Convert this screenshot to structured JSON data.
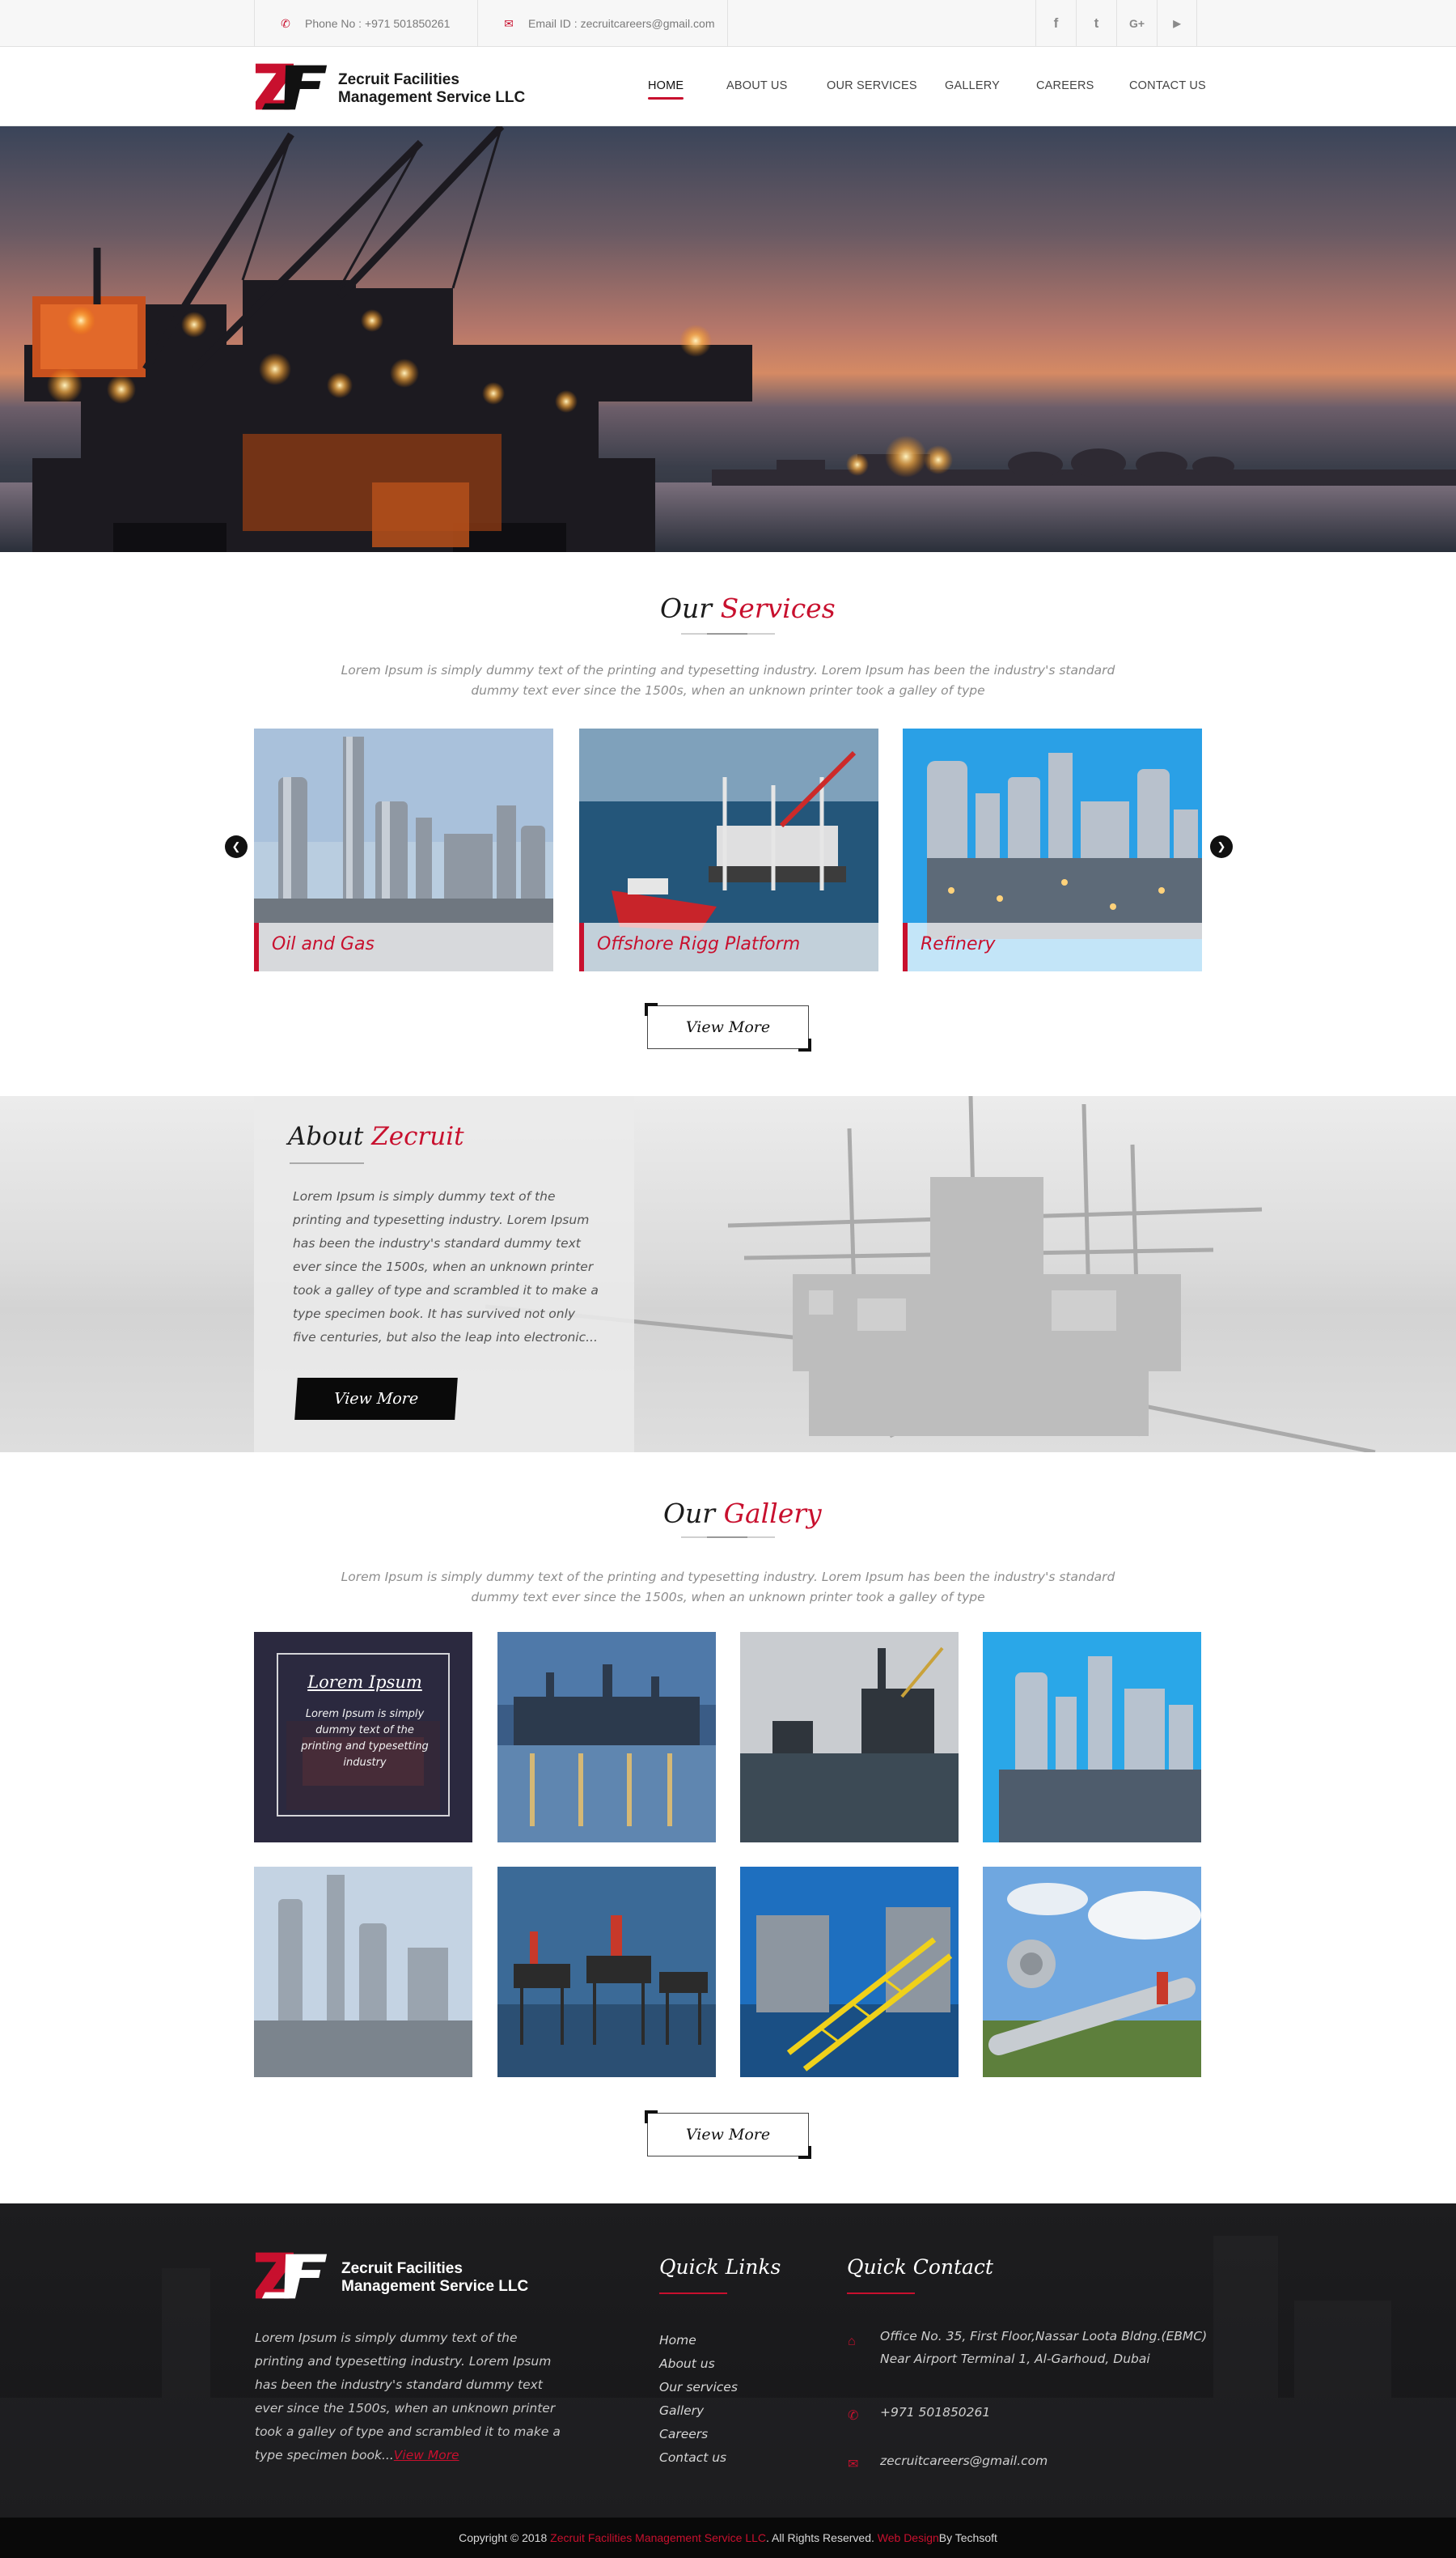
{
  "topbar": {
    "phone": "Phone No : +971 501850261",
    "email": "Email ID : zecruitcareers@gmail.com",
    "social": [
      {
        "name": "facebook",
        "glyph": "f"
      },
      {
        "name": "twitter",
        "glyph": "t"
      },
      {
        "name": "google-plus",
        "glyph": "G+"
      },
      {
        "name": "youtube",
        "glyph": "▶"
      }
    ]
  },
  "brand": {
    "line1": "Zecruit Facilities",
    "line2": "Management Service LLC",
    "accent": "#c8102e"
  },
  "nav": [
    {
      "label": "HOME",
      "active": true
    },
    {
      "label": "ABOUT US",
      "active": false
    },
    {
      "label": "OUR SERVICES",
      "active": false
    },
    {
      "label": "GALLERY",
      "active": false
    },
    {
      "label": "CAREERS",
      "active": false
    },
    {
      "label": "CONTACT US",
      "active": false
    }
  ],
  "services": {
    "title_dark": "Our",
    "title_red": "Services",
    "intro": "Lorem Ipsum is simply dummy text of the printing and typesetting industry. Lorem Ipsum has been the industry's standard dummy text ever since the 1500s, when an unknown printer took a galley of type",
    "cards": [
      {
        "label": "Oil and Gas"
      },
      {
        "label": "Offshore Rigg Platform"
      },
      {
        "label": "Refinery"
      }
    ],
    "button": "View More"
  },
  "about": {
    "title_dark": "About",
    "title_red": "Zecruit",
    "text": "Lorem Ipsum is simply dummy text of the printing and typesetting industry. Lorem Ipsum has been the industry's standard dummy text ever since the 1500s, when an unknown printer took a galley of type and scrambled it to make a type specimen book. It has survived not only five centuries, but also the leap into electronic...",
    "button": "View More"
  },
  "gallery": {
    "title_dark": "Our",
    "title_red": "Gallery",
    "intro": "Lorem Ipsum is simply dummy text of the printing and typesetting industry. Lorem Ipsum has been the industry's standard dummy text ever since the 1500s, when an unknown printer took a galley of type",
    "overlay_title": "Lorem Ipsum",
    "overlay_text": "Lorem Ipsum is simply dummy text of the printing and typesetting industry",
    "button": "View More"
  },
  "footer": {
    "about_text": "Lorem Ipsum is simply dummy text of the printing and typesetting industry. Lorem Ipsum has been the industry's standard dummy text ever since the 1500s, when an unknown printer took a galley of type and scrambled it to make a type specimen book...",
    "about_link": "View More",
    "quick_links_title": "Quick Links",
    "quick_links": [
      "Home",
      "About us",
      "Our services",
      "Gallery",
      "Careers",
      "Contact us"
    ],
    "quick_contact_title": "Quick Contact",
    "address": "Office No. 35, First Floor,Nassar Loota Bldng.(EBMC) Near Airport Terminal 1, Al-Garhoud, Dubai",
    "phone": "+971 501850261",
    "email": "zecruitcareers@gmail.com"
  },
  "copyright": {
    "prefix": "Copyright © 2018 ",
    "company": "Zecruit Facilities Management Service LLC",
    "middle": ". All  Rights Reserved. ",
    "webdesign": "Web Design",
    "suffix": " By Techsoft"
  }
}
